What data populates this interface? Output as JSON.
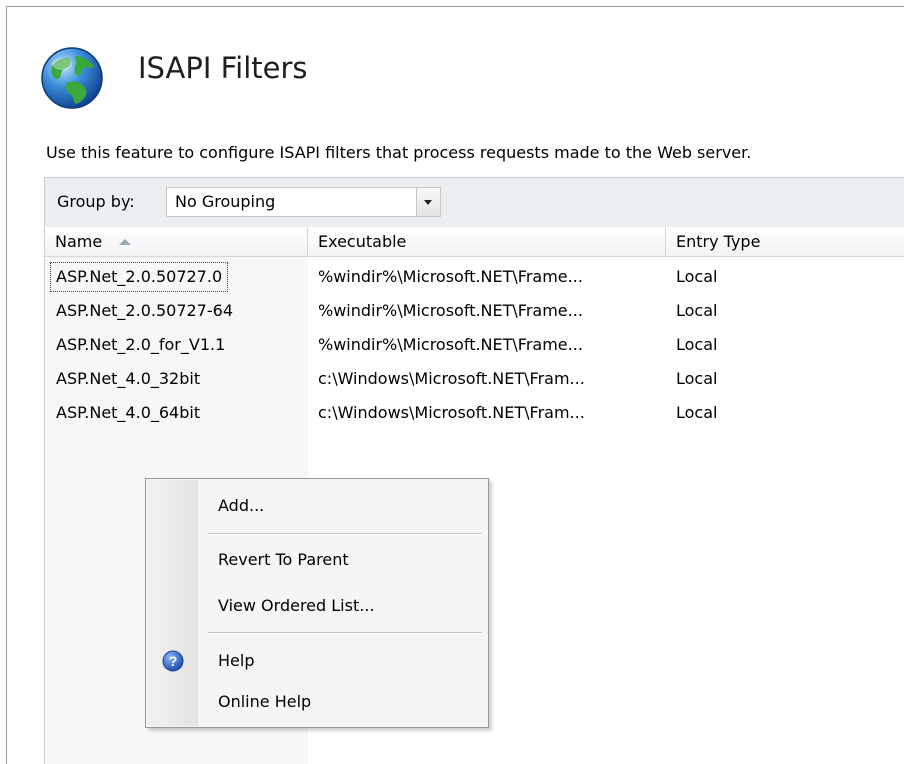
{
  "header": {
    "title": "ISAPI Filters",
    "icon": "globe-icon",
    "description": "Use this feature to configure ISAPI filters that process requests made to the Web server."
  },
  "group_by": {
    "label": "Group by:",
    "value": "No Grouping"
  },
  "table": {
    "columns": [
      "Name",
      "Executable",
      "Entry Type"
    ],
    "sort_column": "Name",
    "rows": [
      {
        "name": "ASP.Net_2.0.50727.0",
        "executable": "%windir%\\Microsoft.NET\\Frame...",
        "entry_type": "Local"
      },
      {
        "name": "ASP.Net_2.0.50727-64",
        "executable": "%windir%\\Microsoft.NET\\Frame...",
        "entry_type": "Local"
      },
      {
        "name": "ASP.Net_2.0_for_V1.1",
        "executable": "%windir%\\Microsoft.NET\\Frame...",
        "entry_type": "Local"
      },
      {
        "name": "ASP.Net_4.0_32bit",
        "executable": "c:\\Windows\\Microsoft.NET\\Fram...",
        "entry_type": "Local"
      },
      {
        "name": "ASP.Net_4.0_64bit",
        "executable": "c:\\Windows\\Microsoft.NET\\Fram...",
        "entry_type": "Local"
      }
    ]
  },
  "context_menu": {
    "add": "Add...",
    "revert": "Revert To Parent",
    "view_ordered": "View Ordered List...",
    "help": "Help",
    "online_help": "Online Help"
  },
  "colors": {
    "help_icon_blue": "#2a62c9",
    "globe_blue": "#1d6fc4",
    "globe_green": "#3aa83a"
  }
}
